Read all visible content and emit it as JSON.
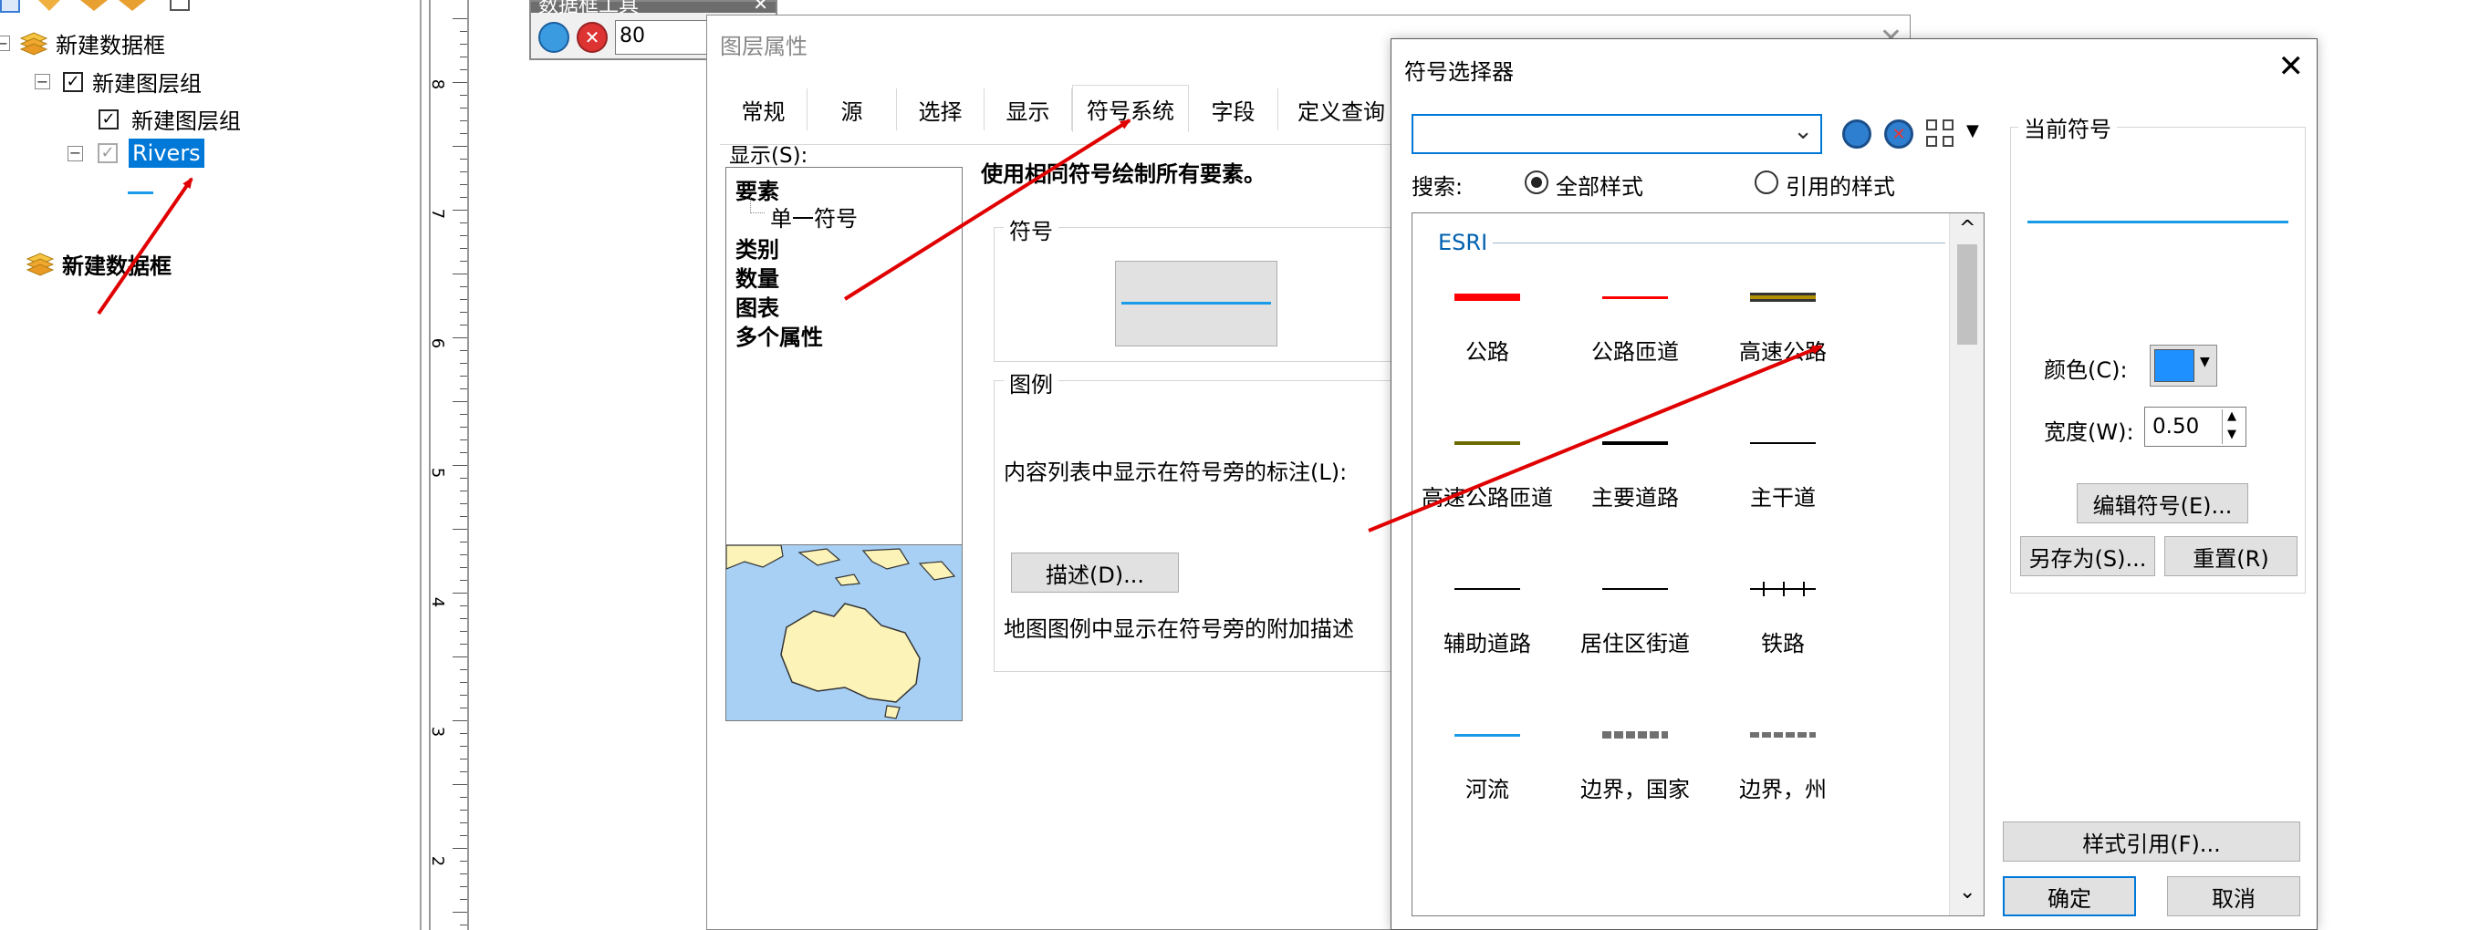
{
  "toc": {
    "items": [
      {
        "label": "新建数据框"
      },
      {
        "label": "新建图层组"
      },
      {
        "label": "新建图层组"
      },
      {
        "label": "Rivers"
      },
      {
        "label": "新建数据框"
      }
    ]
  },
  "ruler": {
    "labels": [
      "8",
      "7",
      "6",
      "5",
      "4",
      "3",
      "2"
    ]
  },
  "small_toolbar": {
    "title": "数据框工具",
    "scale_value": "80"
  },
  "layer_props": {
    "title": "图层属性",
    "tabs": [
      "常规",
      "源",
      "选择",
      "显示",
      "符号系统",
      "字段",
      "定义查询"
    ],
    "show_label": "显示(S):",
    "show_items": [
      "要素",
      "单一符号",
      "类别",
      "数量",
      "图表",
      "多个属性"
    ],
    "desc_title": "使用相同符号绘制所有要素。",
    "symbol_group": "符号",
    "legend_group": "图例",
    "legend_label": "内容列表中显示在符号旁的标注(L):",
    "describe_button": "描述(D)...",
    "extra_desc": "地图图例中显示在符号旁的附加描述"
  },
  "symbol_selector": {
    "title": "符号选择器",
    "search_label": "搜索:",
    "radio_all": "全部样式",
    "radio_ref": "引用的样式",
    "esri_label": "ESRI",
    "symbols": [
      {
        "label": "公路",
        "color": "#ff0000"
      },
      {
        "label": "公路匝道",
        "color": "#ff0000"
      },
      {
        "label": "高速公路",
        "color": "#b09000"
      },
      {
        "label": "高速公路匝道",
        "color": "#6b6b00"
      },
      {
        "label": "主要道路",
        "color": "#000000"
      },
      {
        "label": "主干道",
        "color": "#000000"
      },
      {
        "label": "辅助道路",
        "color": "#000000"
      },
      {
        "label": "居住区街道",
        "color": "#000000"
      },
      {
        "label": "铁路",
        "color": "#000000"
      },
      {
        "label": "河流",
        "color": "#1a9be8"
      },
      {
        "label": "边界，国家",
        "color": "#707070"
      },
      {
        "label": "边界，州",
        "color": "#707070"
      }
    ],
    "current_label": "当前符号",
    "color_label": "颜色(C):",
    "color_value": "#1e90ff",
    "width_label": "宽度(W):",
    "width_value": "0.50",
    "edit_button": "编辑符号(E)...",
    "saveas_button": "另存为(S)...",
    "reset_button": "重置(R)",
    "style_ref_button": "样式引用(F)...",
    "ok_button": "确定",
    "cancel_button": "取消"
  },
  "colors": {
    "accent": "#0078d7",
    "highlight": "#0078d7",
    "arrow": "#e00000"
  }
}
